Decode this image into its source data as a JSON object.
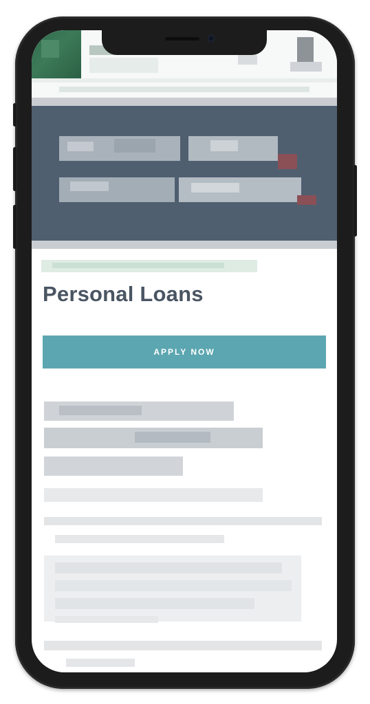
{
  "page": {
    "title": "Personal Loans",
    "apply_button_label": "APPLY NOW"
  },
  "colors": {
    "button": "#5ba6b0",
    "title": "#4a5563",
    "hero_band": "#4f5f70",
    "brand_green": "#2f6b4c",
    "device_frame": "#1c1c1c"
  },
  "icons": {
    "logo": "site-logo-icon",
    "camera": "camera-icon",
    "speaker": "speaker-icon"
  }
}
